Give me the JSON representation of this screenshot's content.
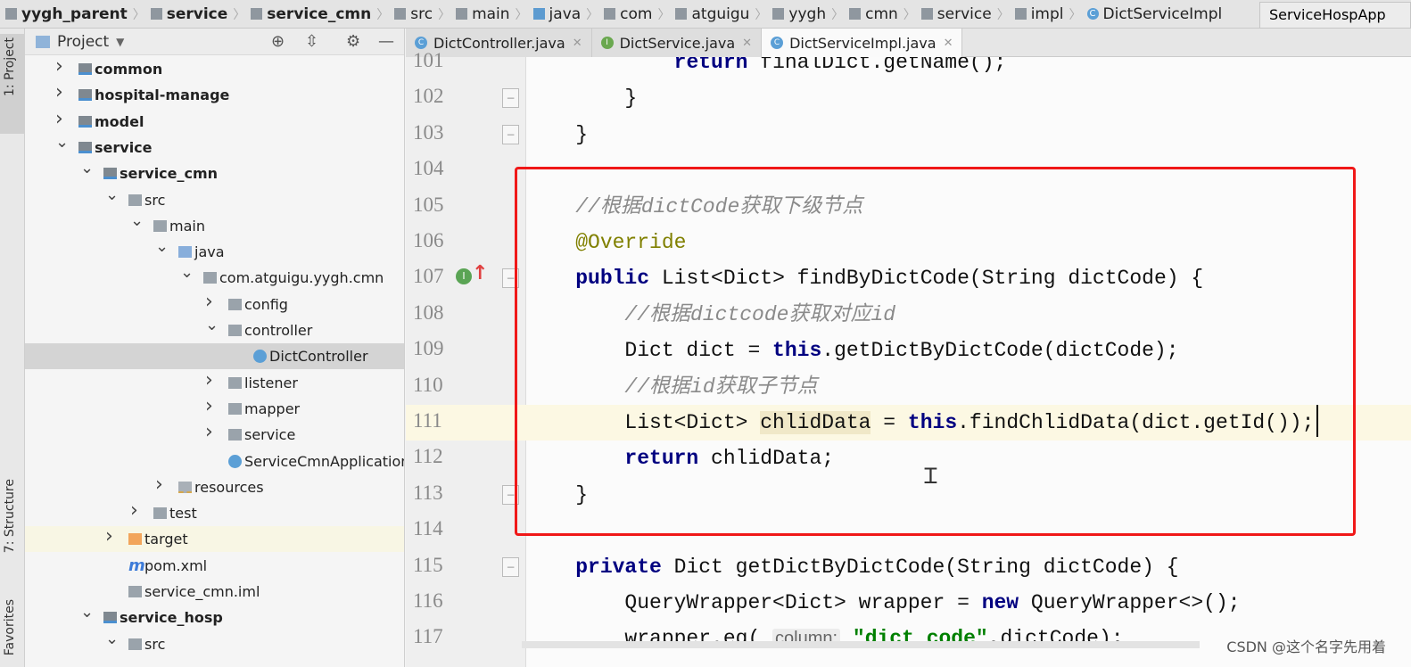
{
  "breadcrumbs": [
    {
      "label": "yygh_parent",
      "icon": "module-icon",
      "bold": true
    },
    {
      "label": "service",
      "icon": "module-icon",
      "bold": true
    },
    {
      "label": "service_cmn",
      "icon": "module-icon",
      "bold": true
    },
    {
      "label": "src",
      "icon": "folder-icon"
    },
    {
      "label": "main",
      "icon": "folder-icon"
    },
    {
      "label": "java",
      "icon": "source-folder-icon"
    },
    {
      "label": "com",
      "icon": "package-icon"
    },
    {
      "label": "atguigu",
      "icon": "package-icon"
    },
    {
      "label": "yygh",
      "icon": "package-icon"
    },
    {
      "label": "cmn",
      "icon": "package-icon"
    },
    {
      "label": "service",
      "icon": "package-icon"
    },
    {
      "label": "impl",
      "icon": "package-icon"
    },
    {
      "label": "DictServiceImpl",
      "icon": "class-icon"
    }
  ],
  "run_config": "ServiceHospApp",
  "toolstrip": {
    "project": "1: Project",
    "structure": "7: Structure",
    "favorites": "Favorites"
  },
  "sidebar": {
    "title": "Project",
    "items": [
      {
        "label": "common",
        "level": 1,
        "arrow": "right",
        "icon": "mod",
        "bold": true
      },
      {
        "label": "hospital-manage",
        "level": 1,
        "arrow": "right",
        "icon": "mod",
        "bold": true
      },
      {
        "label": "model",
        "level": 1,
        "arrow": "right",
        "icon": "mod",
        "bold": true
      },
      {
        "label": "service",
        "level": 1,
        "arrow": "down",
        "icon": "mod",
        "bold": true
      },
      {
        "label": "service_cmn",
        "level": 2,
        "arrow": "down",
        "icon": "mod",
        "bold": true
      },
      {
        "label": "src",
        "level": 3,
        "arrow": "down",
        "icon": "dir"
      },
      {
        "label": "main",
        "level": 4,
        "arrow": "down",
        "icon": "dir"
      },
      {
        "label": "java",
        "level": 5,
        "arrow": "down",
        "icon": "src"
      },
      {
        "label": "com.atguigu.yygh.cmn",
        "level": 6,
        "arrow": "down",
        "icon": "dir"
      },
      {
        "label": "config",
        "level": 7,
        "arrow": "right",
        "icon": "dir"
      },
      {
        "label": "controller",
        "level": 7,
        "arrow": "down",
        "icon": "dir"
      },
      {
        "label": "DictController",
        "level": 8,
        "arrow": "",
        "icon": "cls",
        "selected": true
      },
      {
        "label": "listener",
        "level": 7,
        "arrow": "right",
        "icon": "dir"
      },
      {
        "label": "mapper",
        "level": 7,
        "arrow": "right",
        "icon": "dir"
      },
      {
        "label": "service",
        "level": 7,
        "arrow": "right",
        "icon": "dir"
      },
      {
        "label": "ServiceCmnApplication",
        "level": 7,
        "arrow": "",
        "icon": "cls"
      },
      {
        "label": "resources",
        "level": 5,
        "arrow": "right",
        "icon": "res"
      },
      {
        "label": "test",
        "level": 4,
        "arrow": "right",
        "icon": "dir"
      },
      {
        "label": "target",
        "level": 3,
        "arrow": "right",
        "icon": "tgt",
        "ignored": true
      },
      {
        "label": "pom.xml",
        "level": 3,
        "arrow": "",
        "icon": "xml"
      },
      {
        "label": "service_cmn.iml",
        "level": 3,
        "arrow": "",
        "icon": "dir"
      },
      {
        "label": "service_hosp",
        "level": 2,
        "arrow": "down",
        "icon": "mod",
        "bold": true
      },
      {
        "label": "src",
        "level": 3,
        "arrow": "down",
        "icon": "dir"
      }
    ]
  },
  "tabs": [
    {
      "label": "DictController.java",
      "icon": "class-icon"
    },
    {
      "label": "DictService.java",
      "icon": "interface-icon"
    },
    {
      "label": "DictServiceImpl.java",
      "icon": "class-icon",
      "active": true
    }
  ],
  "editor": {
    "lines": [
      {
        "n": "101",
        "segs": [
          [
            "            "
          ],
          [
            "return",
            "kw"
          ],
          [
            " finalDict.getName();"
          ]
        ]
      },
      {
        "n": "102",
        "segs": [
          [
            "        }"
          ]
        ],
        "fold": true
      },
      {
        "n": "103",
        "segs": [
          [
            "    }"
          ]
        ],
        "fold": true
      },
      {
        "n": "104",
        "segs": [
          [
            ""
          ]
        ]
      },
      {
        "n": "105",
        "segs": [
          [
            "    "
          ],
          [
            "//根据dictCode获取下级节点",
            "cm"
          ]
        ]
      },
      {
        "n": "106",
        "segs": [
          [
            "    "
          ],
          [
            "@Override",
            "an"
          ]
        ]
      },
      {
        "n": "107",
        "segs": [
          [
            "    "
          ],
          [
            "public",
            "kw"
          ],
          [
            " List<Dict> findByDictCode(String dictCode) {"
          ]
        ],
        "fold": true,
        "gutter_icon": "implements-method-icon"
      },
      {
        "n": "108",
        "segs": [
          [
            "        "
          ],
          [
            "//根据dictcode获取对应id",
            "cm"
          ]
        ]
      },
      {
        "n": "109",
        "segs": [
          [
            "        Dict dict = "
          ],
          [
            "this",
            "kw"
          ],
          [
            ".getDictByDictCode(dictCode);"
          ]
        ]
      },
      {
        "n": "110",
        "segs": [
          [
            "        "
          ],
          [
            "//根据id获取子节点",
            "cm"
          ]
        ]
      },
      {
        "n": "111",
        "segs": [
          [
            "        List<Dict> "
          ],
          [
            "chlidData",
            "hi"
          ],
          [
            " = "
          ],
          [
            "this",
            "kw"
          ],
          [
            ".findChlidData(dict.getId());"
          ]
        ],
        "current": true
      },
      {
        "n": "112",
        "segs": [
          [
            "        "
          ],
          [
            "return",
            "kw"
          ],
          [
            " chlidData;"
          ]
        ]
      },
      {
        "n": "113",
        "segs": [
          [
            "    }"
          ]
        ],
        "fold": true
      },
      {
        "n": "114",
        "segs": [
          [
            ""
          ]
        ]
      },
      {
        "n": "115",
        "segs": [
          [
            "    "
          ],
          [
            "private",
            "kw"
          ],
          [
            " Dict getDictByDictCode(String dictCode) {"
          ]
        ],
        "fold": true
      },
      {
        "n": "116",
        "segs": [
          [
            "        QueryWrapper<Dict> wrapper = "
          ],
          [
            "new",
            "kw"
          ],
          [
            " QueryWrapper<>();"
          ]
        ]
      },
      {
        "n": "117",
        "segs": [
          [
            "        wrapper.eq( "
          ],
          [
            "column:",
            "hint"
          ],
          [
            " "
          ],
          [
            "\"dict_code\"",
            "st"
          ],
          [
            ",dictCode);"
          ]
        ]
      }
    ]
  },
  "highlight_color": "#f01818",
  "watermark": "CSDN @这个名字先用着"
}
